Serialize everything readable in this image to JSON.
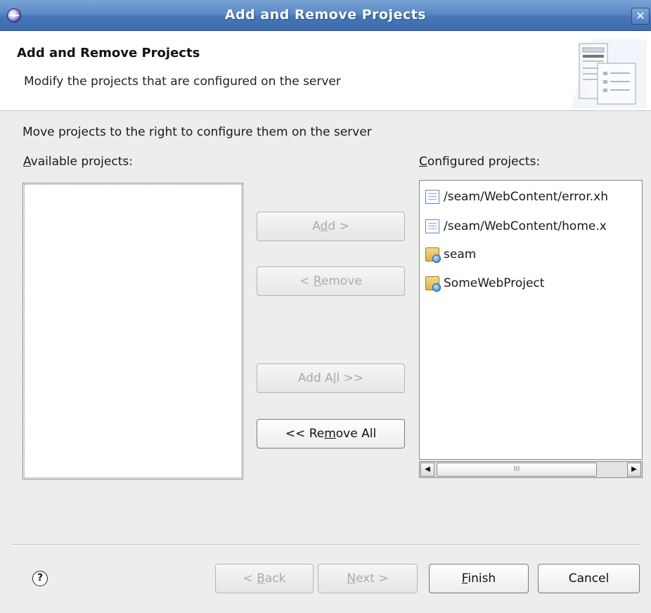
{
  "window": {
    "title": "Add and Remove Projects",
    "close_glyph": "✕",
    "app_icon": "eclipse-icon"
  },
  "header": {
    "title": "Add and Remove Projects",
    "description": "Modify the projects that are configured on the server",
    "graphic_icon": "server-document-icon"
  },
  "body": {
    "instruction": "Move projects to the right to configure them on the server",
    "available_label_mnemonic": "A",
    "available_label_rest": "vailable projects:",
    "configured_label_mnemonic": "C",
    "configured_label_rest": "onfigured projects:",
    "available_projects": []
  },
  "move_buttons": {
    "add": {
      "pre": "A",
      "mn": "d",
      "post": "d >",
      "enabled": false
    },
    "remove": {
      "pre": "< ",
      "mn": "R",
      "post": "emove",
      "enabled": false
    },
    "add_all": {
      "pre": "Add A",
      "mn": "l",
      "post": "l >>",
      "enabled": false
    },
    "remove_all": {
      "pre": "<< Re",
      "mn": "m",
      "post": "ove All",
      "enabled": true
    }
  },
  "configured_projects": [
    {
      "label": "/seam/WebContent/error.xh",
      "icon": "file-icon"
    },
    {
      "label": "/seam/WebContent/home.x",
      "icon": "file-icon"
    },
    {
      "label": "seam",
      "icon": "web-project-icon"
    },
    {
      "label": "SomeWebProject",
      "icon": "web-project-icon"
    }
  ],
  "scrollbar": {
    "left_arrow": "◀",
    "right_arrow": "▶",
    "thumb_grip": "III"
  },
  "footer": {
    "help_glyph": "?",
    "back": {
      "pre": "< ",
      "mn": "B",
      "post": "ack",
      "enabled": false
    },
    "next": {
      "pre": "",
      "mn": "N",
      "post": "ext >",
      "enabled": false
    },
    "finish": {
      "pre": "",
      "mn": "F",
      "post": "inish",
      "enabled": true
    },
    "cancel": {
      "label": "Cancel",
      "enabled": true
    }
  }
}
